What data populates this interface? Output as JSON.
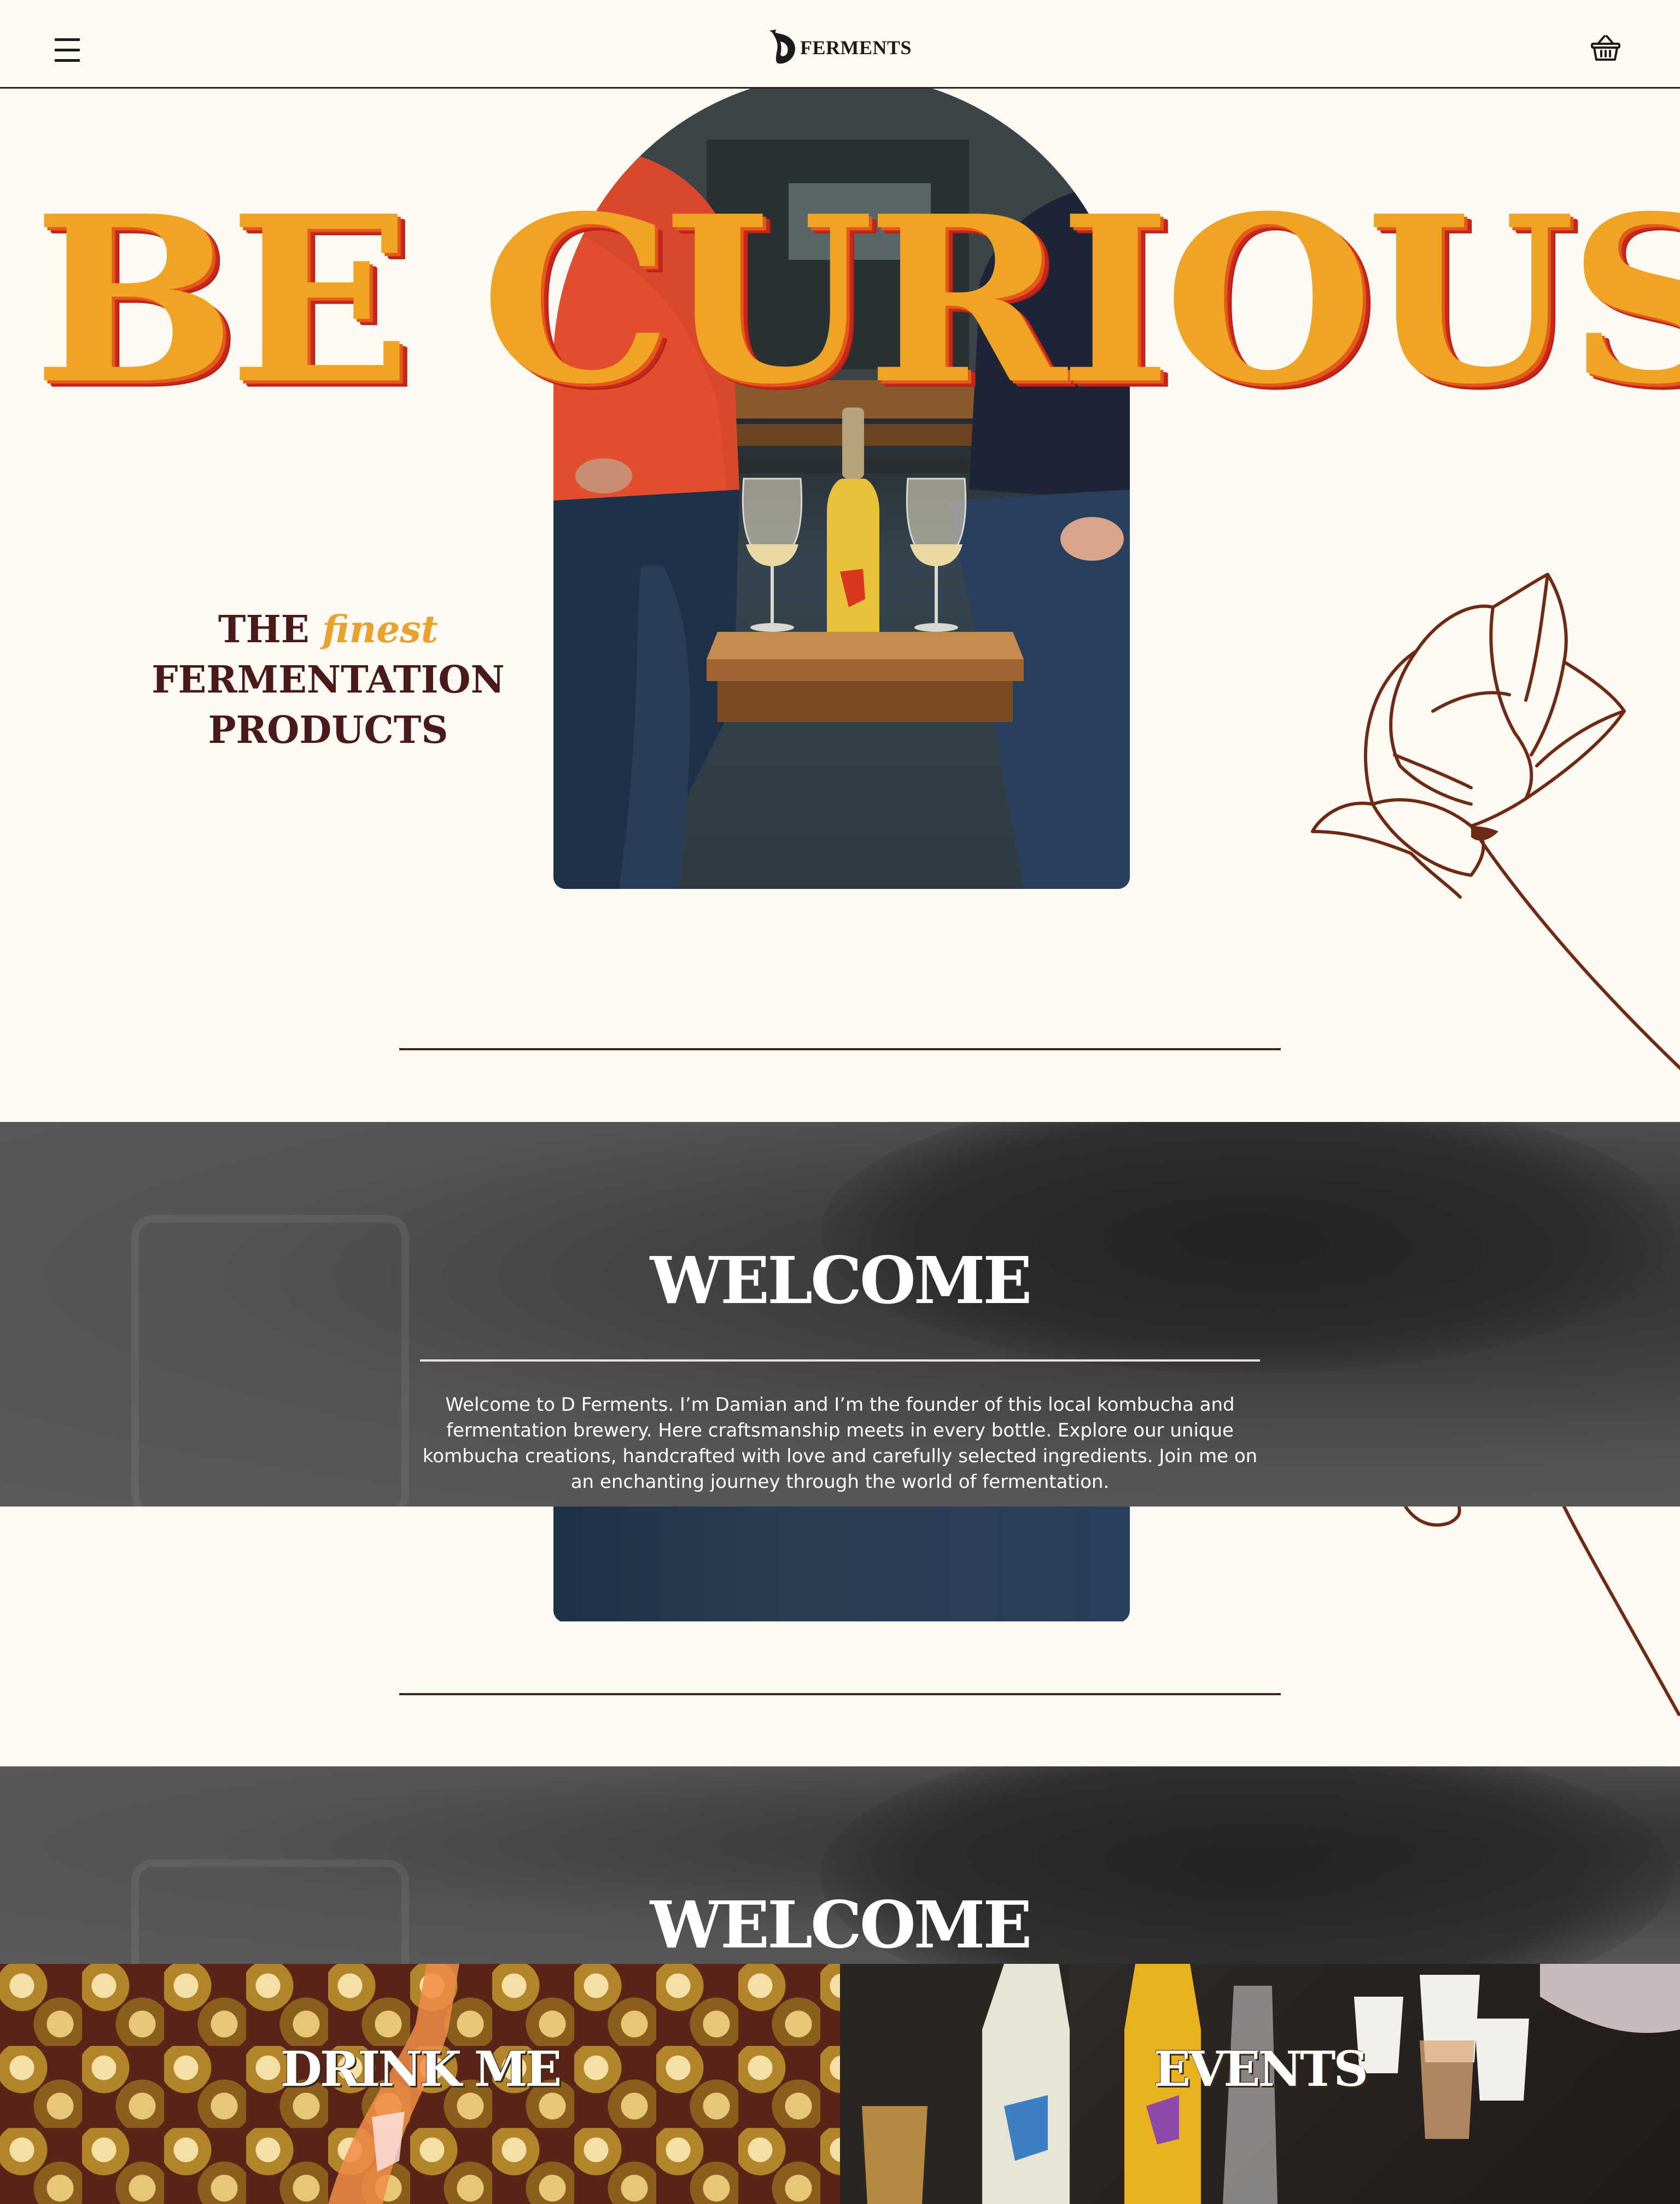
{
  "header": {
    "logo_text": "FERMENTS",
    "menu_icon": "hamburger-menu-icon",
    "cart_icon": "basket-icon"
  },
  "hero": {
    "title": "BE CURIOUS",
    "tagline_the": "THE",
    "tagline_finest": "finest",
    "tagline_line2": "FERMENTATION",
    "tagline_line3": "PRODUCTS"
  },
  "welcome": {
    "title": "WELCOME",
    "body": "Welcome to D Ferments. I’m Damian and I’m the founder of this local kombucha and fermentation brewery. Here craftsmanship meets in every bottle. Explore our unique kombucha creations, handcrafted with love and carefully selected ingredients. Join me on an enchanting journey through the world of fermentation."
  },
  "tiles": {
    "drink_label": "DRINK ME",
    "events_label": "EVENTS"
  },
  "colors": {
    "background": "#fdfaf3",
    "title_orange": "#f0a423",
    "title_red": "#c8271b",
    "tagline_maroon": "#4a1a1a",
    "accent_gold": "#e9a22c",
    "flower_brown": "#6e2a14"
  }
}
